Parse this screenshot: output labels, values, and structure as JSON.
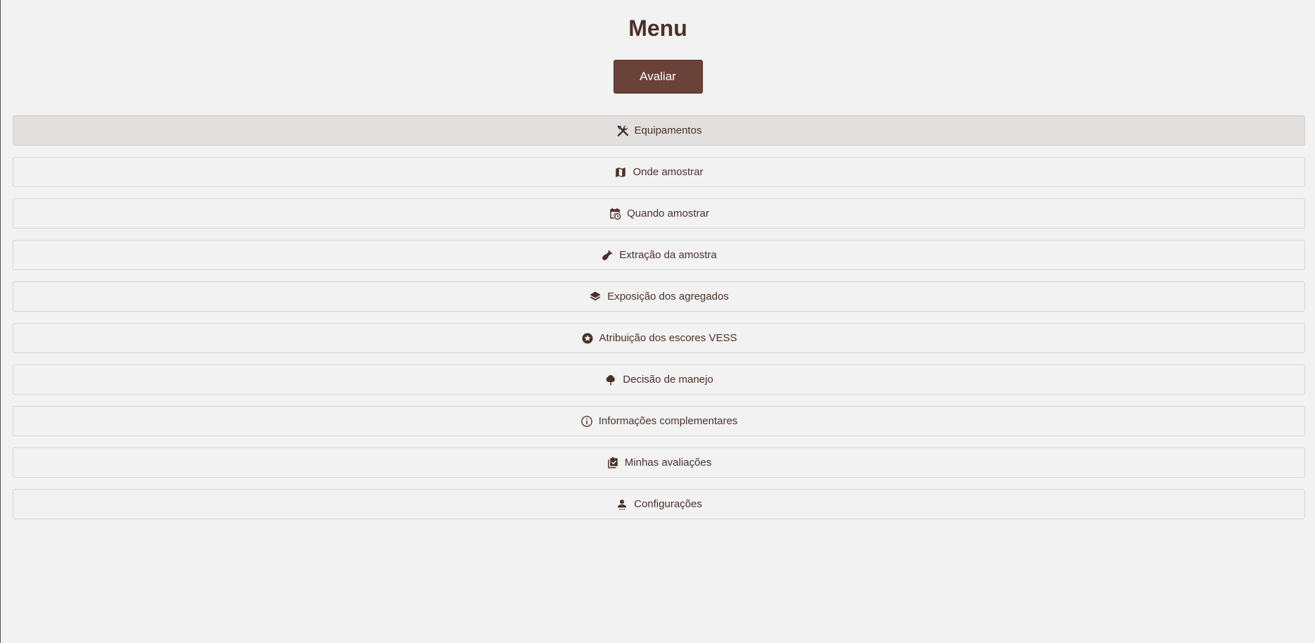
{
  "header": {
    "title": "Menu",
    "evaluate_label": "Avaliar"
  },
  "theme": {
    "accent": "#6b4239",
    "text": "#4a3029",
    "background": "#f2f2f2",
    "active_item_bg": "#e1e0de"
  },
  "menu": {
    "items": [
      {
        "label": "Equipamentos",
        "icon": "tools-icon",
        "active": true
      },
      {
        "label": "Onde amostrar",
        "icon": "map-icon",
        "active": false
      },
      {
        "label": "Quando amostrar",
        "icon": "calendar-clock-icon",
        "active": false
      },
      {
        "label": "Extração da amostra",
        "icon": "shovel-icon",
        "active": false
      },
      {
        "label": "Exposição dos agregados",
        "icon": "layers-icon",
        "active": false
      },
      {
        "label": "Atribuição dos escores VESS",
        "icon": "star-circle-icon",
        "active": false
      },
      {
        "label": "Decisão de manejo",
        "icon": "tree-icon",
        "active": false
      },
      {
        "label": "Informações complementares",
        "icon": "info-icon",
        "active": false
      },
      {
        "label": "Minhas avaliações",
        "icon": "clipboard-check-icon",
        "active": false
      },
      {
        "label": "Configurações",
        "icon": "user-settings-icon",
        "active": false
      }
    ]
  }
}
